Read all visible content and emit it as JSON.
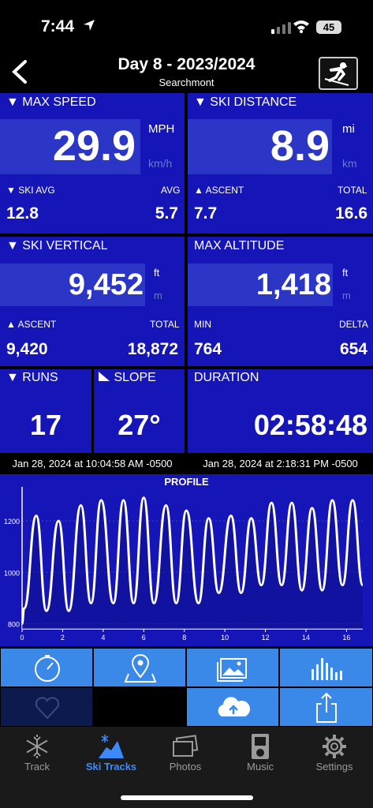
{
  "status": {
    "time": "7:44",
    "battery": "45"
  },
  "header": {
    "title": "Day 8 - 2023/2024",
    "subtitle": "Searchmont"
  },
  "max_speed": {
    "label": "MAX SPEED",
    "value": "29.9",
    "unit_primary": "MPH",
    "unit_secondary": "km/h",
    "left_label": "SKI AVG",
    "left_value": "12.8",
    "right_label": "AVG",
    "right_value": "5.7"
  },
  "ski_distance": {
    "label": "SKI DISTANCE",
    "value": "8.9",
    "unit_primary": "mi",
    "unit_secondary": "km",
    "left_label": "ASCENT",
    "left_value": "7.7",
    "right_label": "TOTAL",
    "right_value": "16.6"
  },
  "ski_vertical": {
    "label": "SKI VERTICAL",
    "value": "9,452",
    "unit_primary": "ft",
    "unit_secondary": "m",
    "left_label": "ASCENT",
    "left_value": "9,420",
    "right_label": "TOTAL",
    "right_value": "18,872"
  },
  "max_altitude": {
    "label": "MAX ALTITUDE",
    "value": "1,418",
    "unit_primary": "ft",
    "unit_secondary": "m",
    "left_label": "MIN",
    "left_value": "764",
    "right_label": "DELTA",
    "right_value": "654"
  },
  "runs": {
    "label": "RUNS",
    "value": "17"
  },
  "slope": {
    "label": "SLOPE",
    "value": "27°"
  },
  "duration": {
    "label": "DURATION",
    "value": "02:58:48"
  },
  "dates": {
    "start": "Jan 28, 2024 at 10:04:58 AM -0500",
    "end": "Jan 28, 2024 at 2:18:31 PM -0500"
  },
  "chart_data": {
    "type": "line",
    "title": "PROFILE",
    "xlabel": "",
    "ylabel": "",
    "xlim": [
      0,
      16.8
    ],
    "ylim": [
      780,
      1320
    ],
    "x_ticks": [
      0,
      2,
      4,
      6,
      8,
      10,
      12,
      14,
      16
    ],
    "y_ticks": [
      800,
      1000,
      1200
    ],
    "series": [
      {
        "x": [
          0,
          0.1,
          0.7,
          1.2,
          1.8,
          2.3,
          2.9,
          3.4,
          3.9,
          4.5,
          5.0,
          5.5,
          6.0,
          6.5,
          7.1,
          7.6,
          8.1,
          8.7,
          9.2,
          9.7,
          10.3,
          10.8,
          11.3,
          11.8,
          12.3,
          12.8,
          13.3,
          13.8,
          14.3,
          14.8,
          15.3,
          15.8,
          16.3,
          16.8
        ],
        "y": [
          800,
          860,
          1220,
          850,
          1200,
          850,
          1260,
          880,
          1280,
          880,
          1280,
          880,
          1290,
          880,
          1260,
          880,
          1240,
          880,
          1210,
          920,
          1220,
          920,
          1210,
          950,
          1270,
          950,
          1270,
          930,
          1250,
          930,
          1280,
          950,
          1280,
          950
        ]
      }
    ]
  },
  "actions": {
    "row1": [
      "timer-icon",
      "map-pin-icon",
      "photos-icon",
      "bar-chart-icon"
    ],
    "row2": [
      "heart-icon",
      "",
      "cloud-upload-icon",
      "share-icon"
    ]
  },
  "tabs": [
    {
      "label": "Track",
      "icon": "snowflake-icon"
    },
    {
      "label": "Ski Tracks",
      "icon": "ski-tracks-icon"
    },
    {
      "label": "Photos",
      "icon": "photos-tab-icon"
    },
    {
      "label": "Music",
      "icon": "music-icon"
    },
    {
      "label": "Settings",
      "icon": "gear-icon"
    }
  ],
  "colors": {
    "panel": "#1515b8",
    "value_box": "#2c36c6",
    "action": "#3a88e8",
    "active_tab": "#3b8bff"
  }
}
